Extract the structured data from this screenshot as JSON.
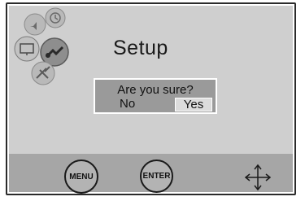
{
  "screen": {
    "title": "Setup",
    "dialog": {
      "question": "Are you sure?",
      "option_no": "No",
      "option_yes": "Yes",
      "selected": "Yes"
    },
    "menu_icons": [
      {
        "name": "audio-icon"
      },
      {
        "name": "clock-icon"
      },
      {
        "name": "display-icon"
      },
      {
        "name": "setup-tools-icon",
        "active": true
      },
      {
        "name": "satellite-icon"
      }
    ]
  },
  "footer": {
    "menu_label": "MENU",
    "enter_label": "ENTER",
    "navigate_icon": "four-way-arrow-icon"
  },
  "colors": {
    "screen_bg": "#cfcfcf",
    "footer_bg": "#a6a6a6",
    "dialog_bg": "#9a9a9a",
    "highlight": "#dcdcdc"
  }
}
